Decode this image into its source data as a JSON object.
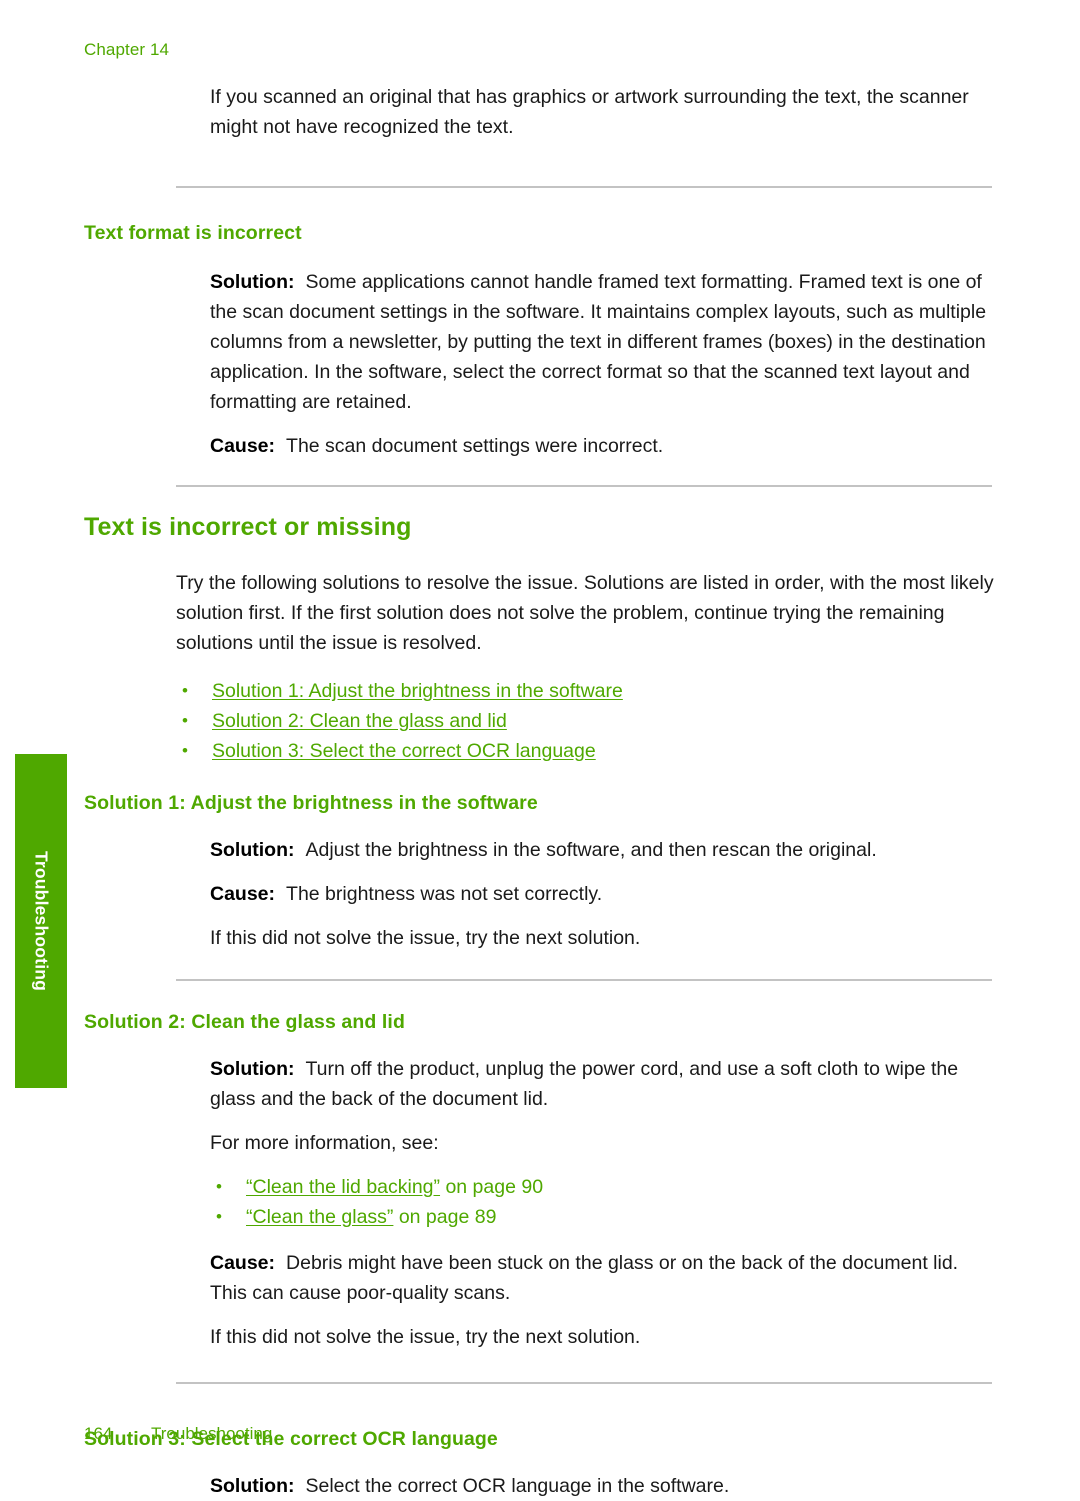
{
  "header": {
    "chapter": "Chapter 14"
  },
  "intro": {
    "paragraph": "If you scanned an original that has graphics or artwork surrounding the text, the scanner might not have recognized the text."
  },
  "text_format_section": {
    "heading": "Text format is incorrect",
    "solution_label": "Solution:",
    "solution_text": "Some applications cannot handle framed text formatting. Framed text is one of the scan document settings in the software. It maintains complex layouts, such as multiple columns from a newsletter, by putting the text in different frames (boxes) in the destination application. In the software, select the correct format so that the scanned text layout and formatting are retained.",
    "cause_label": "Cause:",
    "cause_text": "The scan document settings were incorrect."
  },
  "main_section": {
    "title": "Text is incorrect or missing",
    "intro": "Try the following solutions to resolve the issue. Solutions are listed in order, with the most likely solution first. If the first solution does not solve the problem, continue trying the remaining solutions until the issue is resolved.",
    "solution_links": [
      "Solution 1: Adjust the brightness in the software",
      "Solution 2: Clean the glass and lid",
      "Solution 3: Select the correct OCR language"
    ]
  },
  "solution1": {
    "heading": "Solution 1: Adjust the brightness in the software",
    "solution_label": "Solution:",
    "solution_text": "Adjust the brightness in the software, and then rescan the original.",
    "cause_label": "Cause:",
    "cause_text": "The brightness was not set correctly.",
    "next_text": "If this did not solve the issue, try the next solution."
  },
  "solution2": {
    "heading": "Solution 2: Clean the glass and lid",
    "solution_label": "Solution:",
    "solution_text": "Turn off the product, unplug the power cord, and use a soft cloth to wipe the glass and the back of the document lid.",
    "more_info": "For more information, see:",
    "references": [
      {
        "link": "“Clean the lid backing”",
        "tail": " on page 90"
      },
      {
        "link": "“Clean the glass”",
        "tail": " on page 89"
      }
    ],
    "cause_label": "Cause:",
    "cause_text": "Debris might have been stuck on the glass or on the back of the document lid. This can cause poor-quality scans.",
    "next_text": "If this did not solve the issue, try the next solution."
  },
  "solution3": {
    "heading": "Solution 3: Select the correct OCR language",
    "solution_label": "Solution:",
    "solution_text": "Select the correct OCR language in the software."
  },
  "side_tab": {
    "label": "Troubleshooting"
  },
  "footer": {
    "page_number": "164",
    "section": "Troubleshooting"
  },
  "colors": {
    "accent_green": "#4FA800",
    "rule_gray": "#c3c3c3",
    "body_text": "#1a1a1a"
  }
}
